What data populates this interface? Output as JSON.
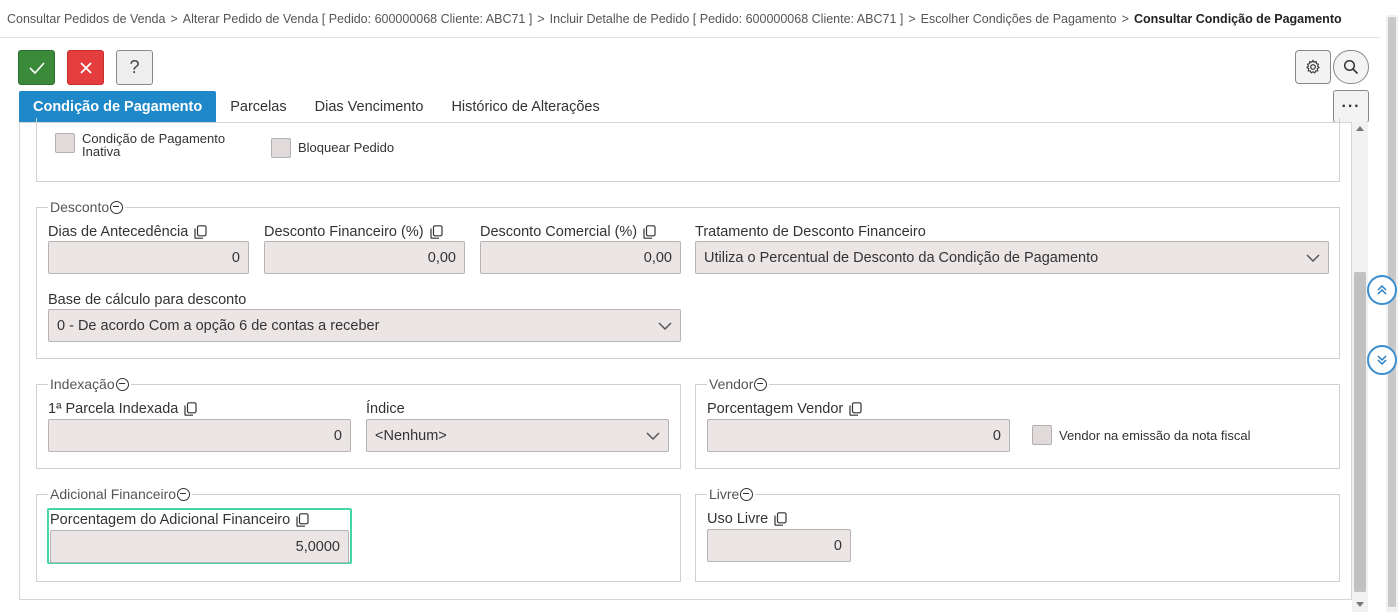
{
  "breadcrumb": {
    "items": [
      "Consultar Pedidos de Venda",
      "Alterar Pedido de Venda [ Pedido: 600000068 Cliente: ABC71 ]",
      "Incluir Detalhe de Pedido [ Pedido: 600000068 Cliente: ABC71 ]",
      "Escolher Condições de Pagamento"
    ],
    "separator": ">",
    "current": "Consultar Condição de Pagamento"
  },
  "toolbar": {
    "confirm_icon": "check-icon",
    "cancel_icon": "close-icon",
    "help_label": "?",
    "settings_icon": "gear-icon",
    "search_icon": "search-icon",
    "more_label": "···"
  },
  "tabs": [
    {
      "label": "Condição de Pagamento",
      "active": true
    },
    {
      "label": "Parcelas",
      "active": false
    },
    {
      "label": "Dias Vencimento",
      "active": false
    },
    {
      "label": "Histórico de Alterações",
      "active": false
    }
  ],
  "status_section": {
    "inactive_label": "Condição de Pagamento Inativa",
    "inactive_line1": "Condição de Pagamento",
    "inactive_line2": "Inativa",
    "inactive_checked": false,
    "block_label": "Bloquear Pedido",
    "block_checked": false
  },
  "desconto": {
    "legend": "Desconto",
    "dias_antecedencia": {
      "label": "Dias de Antecedência",
      "value": "0"
    },
    "desconto_financeiro": {
      "label": "Desconto Financeiro (%)",
      "value": "0,00"
    },
    "desconto_comercial": {
      "label": "Desconto Comercial (%)",
      "value": "0,00"
    },
    "tratamento": {
      "label": "Tratamento de Desconto Financeiro",
      "value": "Utiliza o Percentual de Desconto da Condição de Pagamento"
    },
    "base_calculo": {
      "label": "Base de cálculo para desconto",
      "value": "0 - De acordo Com a opção 6 de contas a receber"
    }
  },
  "indexacao": {
    "legend": "Indexação",
    "parcela_indexada": {
      "label": "1ª Parcela Indexada",
      "value": "0"
    },
    "indice": {
      "label": "Índice",
      "value": "<Nenhum>"
    }
  },
  "vendor": {
    "legend": "Vendor",
    "porcentagem": {
      "label": "Porcentagem Vendor",
      "value": "0"
    },
    "emissao_label": "Vendor na emissão da nota fiscal",
    "emissao_checked": false
  },
  "adicional": {
    "legend": "Adicional Financeiro",
    "porcentagem": {
      "label": "Porcentagem do Adicional Financeiro",
      "value": "5,0000"
    }
  },
  "livre": {
    "legend": "Livre",
    "uso_livre": {
      "label": "Uso Livre",
      "value": "0"
    }
  },
  "colors": {
    "accent": "#1e88c9",
    "confirm": "#3a8a3a",
    "cancel": "#e53d3d",
    "focus": "#46d6a5",
    "field_bg": "#ebe5e5"
  }
}
